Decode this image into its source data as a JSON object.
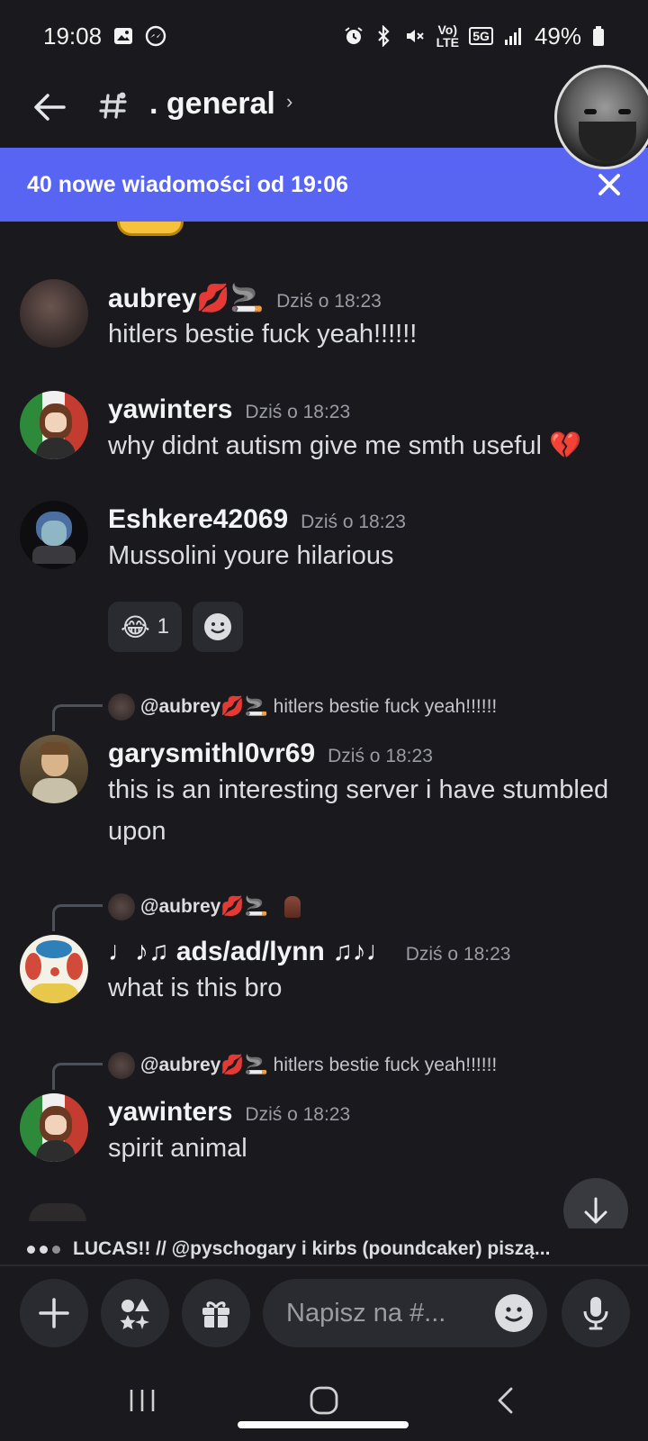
{
  "status_bar": {
    "time": "19:08",
    "network_label": "5G",
    "volte_label": "Vo) LTE",
    "battery": "49%",
    "icons": [
      "image-icon",
      "messenger-icon",
      "alarm-icon",
      "bluetooth-icon",
      "mute-icon",
      "volte-icon",
      "5g-icon",
      "signal-icon",
      "battery-icon"
    ]
  },
  "header": {
    "channel_name": ". general",
    "chevron": "›"
  },
  "banner": {
    "text": "40 nowe wiadomości od 19:06"
  },
  "messages": [
    {
      "username": "aubrey💋🚬",
      "timestamp": "Dziś o 18:23",
      "text": "hitlers bestie fuck yeah!!!!!!"
    },
    {
      "username": "yawinters",
      "timestamp": "Dziś o 18:23",
      "text": "why didnt autism give me smth useful 💔"
    },
    {
      "username": "Eshkere42069",
      "timestamp": "Dziś o 18:23",
      "text": "Mussolini youre hilarious",
      "reaction_emoji": "😂",
      "reaction_count": "1"
    },
    {
      "reply_to_name": "@aubrey💋🚬",
      "reply_to_text": "hitlers bestie fuck yeah!!!!!!",
      "username": "garysmithl0vr69",
      "timestamp": "Dziś o 18:23",
      "text": "this is an interesting server i have stumbled upon"
    },
    {
      "reply_to_name": "@aubrey💋🚬",
      "reply_to_text": "",
      "username": "♩♪♫ ads/ad/lynn ♫♪♩",
      "timestamp": "Dziś o 18:23",
      "text": "what is this bro"
    },
    {
      "reply_to_name": "@aubrey💋🚬",
      "reply_to_text": "hitlers bestie fuck yeah!!!!!!",
      "username": "yawinters",
      "timestamp": "Dziś o 18:23",
      "text": "spirit animal"
    }
  ],
  "typing": {
    "text": "LUCAS!! // @pyschogary i kirbs (poundcaker) piszą..."
  },
  "input": {
    "placeholder": "Napisz na #..."
  },
  "colors": {
    "background": "#1a1a1e",
    "accent": "#5865f2",
    "surface": "#2a2b30"
  }
}
